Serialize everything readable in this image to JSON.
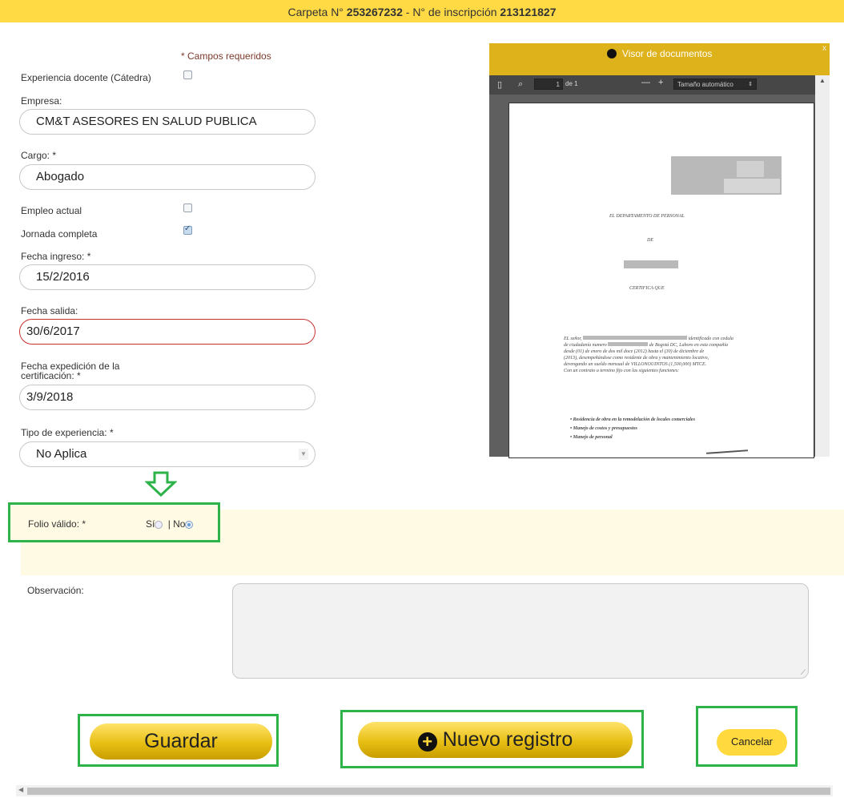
{
  "header": {
    "carpeta_label": "Carpeta N°",
    "carpeta_value": "253267232",
    "sep": "- N° de inscripción",
    "inscripcion_value": "213121827"
  },
  "form": {
    "required_note": "* Campos requeridos",
    "experiencia_docente_label": "Experiencia docente (Cátedra)",
    "empresa_label": "Empresa:",
    "empresa_value": "CM&T ASESORES EN SALUD PUBLICA",
    "cargo_label": "Cargo: *",
    "cargo_value": "Abogado",
    "empleo_actual_label": "Empleo actual",
    "jornada_label": "Jornada completa",
    "fecha_ingreso_label": "Fecha ingreso: *",
    "fecha_ingreso_value": "15/2/2016",
    "fecha_salida_label": "Fecha salida:",
    "fecha_salida_value": "30/6/2017",
    "fecha_exp_label_1": "Fecha expedición de la",
    "fecha_exp_label_2": "certificación: *",
    "fecha_exp_value": "3/9/2018",
    "tipo_label": "Tipo de experiencia: *",
    "tipo_value": "No Aplica"
  },
  "viewer": {
    "title": "Visor de documentos",
    "close": "x",
    "page_num": "1",
    "page_of": "de 1",
    "zoom": "Tamaño automático",
    "doc": {
      "heading": "EL DEPARTAMENTO DE PERSONAL",
      "de": "DE",
      "certifica": "CERTIFICA QUE",
      "para_1": "identificado con cedula",
      "para_2": "de ciudadanía numero",
      "para_3": "de Bogotá DC, Laboro en esta compañía",
      "para_4": "desde (01) de enero de dos mil doce (2012) hasta el (30) de diciembre de",
      "para_5": "(2013), desempeñándose como residente de obra y  mantenimiento locativo,",
      "para_6": "devengando un sueldo mensual de VILLONOUINTOS (1,500,000) MTCE.",
      "para_7": "Con un contrato a termino fijo con las siguientes funciones:",
      "bullet_1": "Residencia de obra en la remodelación de locales comerciales",
      "bullet_2": "Manejo de costos y presupuestos",
      "bullet_3": "Manejo de personal",
      "el_senor": "EL señor,"
    }
  },
  "folio": {
    "label": "Folio válido: *",
    "si": "Sí",
    "pipe": "| No"
  },
  "observacion_label": "Observación:",
  "buttons": {
    "guardar": "Guardar",
    "nuevo": "Nuevo registro",
    "cancelar": "Cancelar"
  }
}
